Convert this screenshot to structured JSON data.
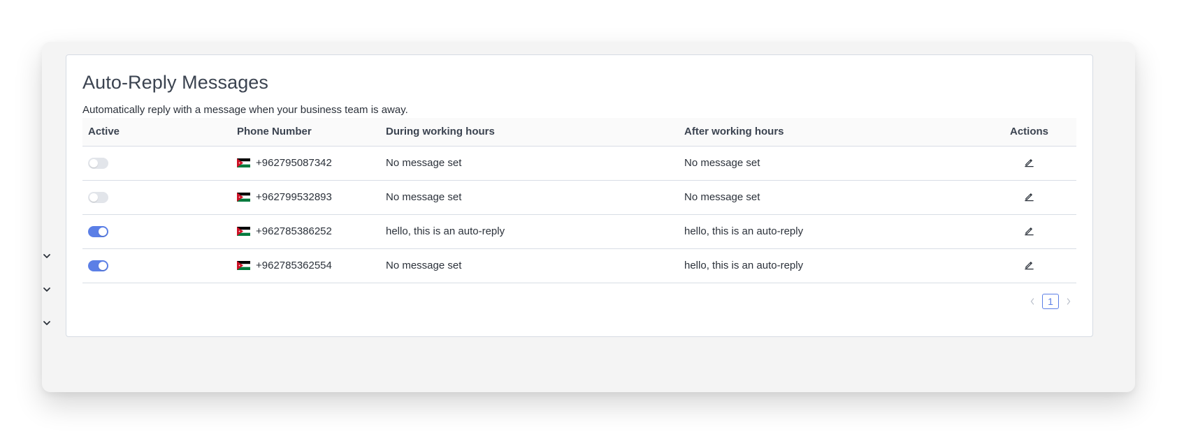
{
  "page": {
    "title": "Auto-Reply Messages",
    "subtitle": "Automatically reply with a message when your business team is away."
  },
  "table": {
    "columns": {
      "active": "Active",
      "phone": "Phone Number",
      "during": "During working hours",
      "after": "After working hours",
      "actions": "Actions"
    },
    "rows": [
      {
        "active": false,
        "phone": "+962795087342",
        "during": "No message set",
        "after": "No message set"
      },
      {
        "active": false,
        "phone": "+962799532893",
        "during": "No message set",
        "after": "No message set"
      },
      {
        "active": true,
        "phone": "+962785386252",
        "during": "hello, this is an auto-reply",
        "after": "hello, this is an auto-reply"
      },
      {
        "active": true,
        "phone": "+962785362554",
        "during": "No message set",
        "after": "hello, this is an auto-reply"
      }
    ]
  },
  "pagination": {
    "current_page": "1"
  },
  "icons": {
    "edit": "edit-pencil-icon",
    "flag": "jordan-flag-icon",
    "chevron": "chevron-down-icon",
    "prev": "chevron-left-icon",
    "next": "chevron-right-icon"
  },
  "colors": {
    "accent": "#5b7fe6",
    "toggle_off": "#e2e5ea",
    "border": "#d8dde5",
    "background": "#f4f4f4"
  }
}
